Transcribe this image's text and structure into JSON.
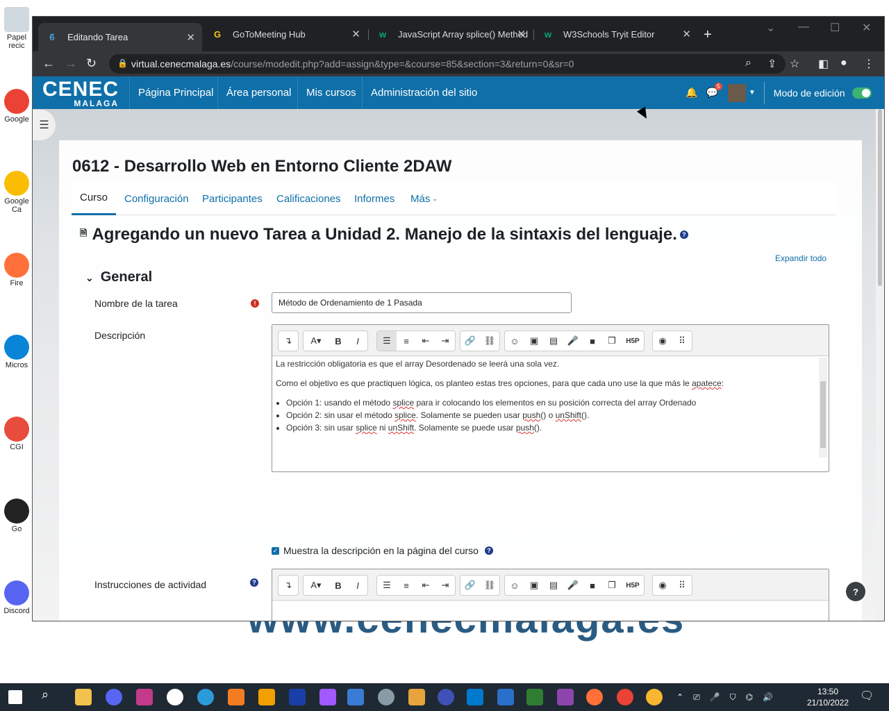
{
  "desktop": {
    "icons": [
      {
        "label": "Papel recic",
        "color": "#d0d8e0"
      },
      {
        "label": "Google",
        "color": "#ea4335"
      },
      {
        "label": "Google Ca",
        "color": "#fbbc04"
      },
      {
        "label": "Fire",
        "color": "#ff7139"
      },
      {
        "label": "Micros",
        "color": "#0a84d6"
      },
      {
        "label": "CGI",
        "color": "#e74c3c"
      },
      {
        "label": "Go",
        "color": "#222222"
      },
      {
        "label": "Discord",
        "color": "#5865f2"
      }
    ],
    "background_text": "www.cenecmalaga.es"
  },
  "browser": {
    "tabs": [
      {
        "title": "Editando Tarea",
        "icon": "moodle-icon",
        "active": true
      },
      {
        "title": "GoToMeeting Hub",
        "icon": "gotomeeting-icon",
        "active": false
      },
      {
        "title": "JavaScript Array splice() Method",
        "icon": "w3schools-icon",
        "active": false
      },
      {
        "title": "W3Schools Tryit Editor",
        "icon": "w3schools-icon",
        "active": false
      }
    ],
    "new_tab": "+",
    "url_host": "virtual.cenecmalaga.es",
    "url_path": "/course/modedit.php?add=assign&type=&course=85&section=3&return=0&sr=0"
  },
  "site": {
    "brand_main": "CENEC",
    "brand_sub": "MALAGA",
    "nav": [
      "Página Principal",
      "Área personal",
      "Mis cursos",
      "Administración del sitio"
    ],
    "notifications_badge": "5",
    "edit_mode_label": "Modo de edición",
    "edit_mode_on": true
  },
  "course": {
    "title": "0612 - Desarrollo Web en Entorno Cliente 2DAW",
    "tabs": [
      "Curso",
      "Configuración",
      "Participantes",
      "Calificaciones",
      "Informes",
      "Más"
    ],
    "active_tab": "Curso"
  },
  "form": {
    "heading": "Agregando un nuevo Tarea a Unidad 2. Manejo de la sintaxis del lenguaje.",
    "expand_all": "Expandir todo",
    "section_general": "General",
    "name_label": "Nombre de la tarea",
    "name_value": "Método de Ordenamiento de 1 Pasada",
    "description_label": "Descripción",
    "description": {
      "p1": "La restricción obligatoria es que el array Desordenado se leerá una sola vez.",
      "p2_before": "Como el objetivo es que practiquen lógica, os planteo estas tres opciones, para que cada uno use la que más le ",
      "p2_spell": "apatece",
      "p2_after": ":",
      "opt1_a": "Opción 1: usando el método ",
      "opt1_b": "splice",
      "opt1_c": " para ir colocando los elementos en su posición correcta del array Ordenado",
      "opt2_a": "Opción 2: sin usar el método ",
      "opt2_b": "splice",
      "opt2_c": ". Solamente se pueden usar ",
      "opt2_d": "push",
      "opt2_e": "() o ",
      "opt2_f": "unShift",
      "opt2_g": "().",
      "opt3_a": "Opción 3: sin usar ",
      "opt3_b": "splice",
      "opt3_c": " ni ",
      "opt3_d": "unShift",
      "opt3_e": ". Solamente se puede usar ",
      "opt3_f": "push",
      "opt3_g": "()."
    },
    "show_description_label": "Muestra la descripción en la página del curso",
    "show_description_checked": true,
    "instructions_label": "Instrucciones de actividad",
    "toolbar_buttons": [
      "collapse-icon",
      "font-icon",
      "bold-icon",
      "italic-icon",
      "bullet-list-icon",
      "numbered-list-icon",
      "outdent-icon",
      "indent-icon",
      "link-icon",
      "unlink-icon",
      "emoji-icon",
      "image-icon",
      "media-file-icon",
      "record-audio-icon",
      "record-video-icon",
      "manage-files-icon",
      "h5p-icon",
      "accessibility-icon",
      "more-icon"
    ]
  },
  "help_button": "?",
  "taskbar": {
    "time": "13:50",
    "date": "21/10/2022"
  }
}
